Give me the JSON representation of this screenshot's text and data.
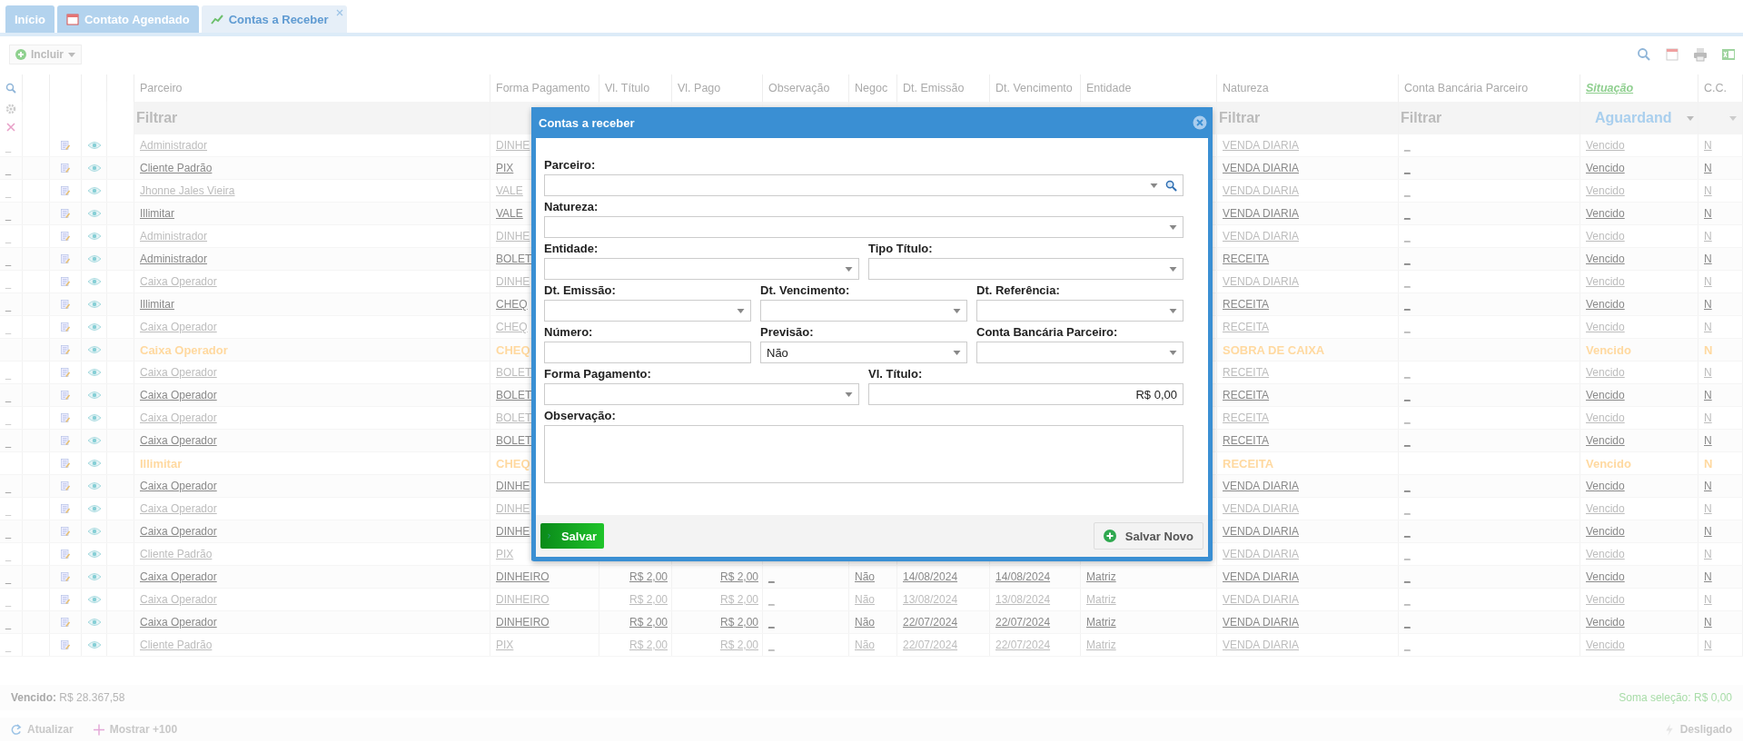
{
  "tabs": [
    {
      "label": "Início",
      "selected": false
    },
    {
      "label": "Contato Agendado",
      "selected": false
    },
    {
      "label": "Contas a Receber",
      "selected": true
    }
  ],
  "toolbar": {
    "add_button": "Incluir"
  },
  "columns": [
    {
      "label": "Parceiro",
      "sorted": false
    },
    {
      "label": "Forma Pagamento",
      "sorted": false
    },
    {
      "label": "Vl. Título",
      "sorted": false
    },
    {
      "label": "Vl. Pago",
      "sorted": false
    },
    {
      "label": "Observação",
      "sorted": false
    },
    {
      "label": "Negoc",
      "sorted": false
    },
    {
      "label": "Dt. Emissão",
      "sorted": false
    },
    {
      "label": "Dt. Vencimento",
      "sorted": false
    },
    {
      "label": "Entidade",
      "sorted": false
    },
    {
      "label": "Natureza",
      "sorted": false
    },
    {
      "label": "Conta Bancária Parceiro",
      "sorted": false
    },
    {
      "label": "Situação",
      "sorted": true
    },
    {
      "label": "C.C.",
      "sorted": false
    }
  ],
  "filters": {
    "parceiro": {
      "placeholder": "Filtrar"
    },
    "natureza": {
      "placeholder": "Filtrar"
    },
    "conta": {
      "placeholder": "Filtrar"
    },
    "situacao": {
      "value": "Aguardand"
    }
  },
  "rows": [
    {
      "warning": false,
      "lead": "_",
      "parceiro": "Administrador",
      "forma": "DINHE",
      "natureza": "VENDA DIARIA",
      "conta": "_",
      "situacao": "Vencido",
      "cc": "N"
    },
    {
      "warning": false,
      "lead": "_",
      "parceiro": "Cliente Padrão",
      "forma": "PIX",
      "natureza": "VENDA DIARIA",
      "conta": "_",
      "situacao": "Vencido",
      "cc": "N"
    },
    {
      "warning": false,
      "lead": "_",
      "parceiro": "Jhonne Jales Vieira",
      "forma": "VALE",
      "natureza": "VENDA DIARIA",
      "conta": "_",
      "situacao": "Vencido",
      "cc": "N"
    },
    {
      "warning": false,
      "lead": "_",
      "parceiro": "Illimitar",
      "forma": "VALE",
      "natureza": "VENDA DIARIA",
      "conta": "_",
      "situacao": "Vencido",
      "cc": "N"
    },
    {
      "warning": false,
      "lead": "_",
      "parceiro": "Administrador",
      "forma": "DINHE",
      "natureza": "VENDA DIARIA",
      "conta": "_",
      "situacao": "Vencido",
      "cc": "N"
    },
    {
      "warning": false,
      "lead": "_",
      "parceiro": "Administrador",
      "forma": "BOLET",
      "natureza": "RECEITA",
      "conta": "_",
      "situacao": "Vencido",
      "cc": "N"
    },
    {
      "warning": false,
      "lead": "_",
      "parceiro": "Caixa Operador",
      "forma": "DINHE",
      "natureza": "VENDA DIARIA",
      "conta": "_",
      "situacao": "Vencido",
      "cc": "N"
    },
    {
      "warning": false,
      "lead": "_",
      "parceiro": "Illimitar",
      "forma": "CHEQ",
      "natureza": "RECEITA",
      "conta": "_",
      "situacao": "Vencido",
      "cc": "N"
    },
    {
      "warning": false,
      "lead": "_",
      "parceiro": "Caixa Operador",
      "forma": "CHEQ",
      "natureza": "RECEITA",
      "conta": "_",
      "situacao": "Vencido",
      "cc": "N"
    },
    {
      "warning": true,
      "parceiro": "Caixa Operador",
      "forma": "CHEQ",
      "natureza": "SOBRA DE CAIXA",
      "situacao": "Vencido",
      "cc": "N"
    },
    {
      "warning": false,
      "lead": "_",
      "parceiro": "Caixa Operador",
      "forma": "BOLET",
      "natureza": "RECEITA",
      "conta": "_",
      "situacao": "Vencido",
      "cc": "N"
    },
    {
      "warning": false,
      "lead": "_",
      "parceiro": "Caixa Operador",
      "forma": "BOLET",
      "natureza": "RECEITA",
      "conta": "_",
      "situacao": "Vencido",
      "cc": "N"
    },
    {
      "warning": false,
      "lead": "_",
      "parceiro": "Caixa Operador",
      "forma": "BOLET",
      "natureza": "RECEITA",
      "conta": "_",
      "situacao": "Vencido",
      "cc": "N"
    },
    {
      "warning": false,
      "lead": "_",
      "parceiro": "Caixa Operador",
      "forma": "BOLET",
      "natureza": "RECEITA",
      "conta": "_",
      "situacao": "Vencido",
      "cc": "N"
    },
    {
      "warning": true,
      "parceiro": "Illimitar",
      "forma": "CHEQ",
      "natureza": "RECEITA",
      "situacao": "Vencido",
      "cc": "N"
    },
    {
      "warning": false,
      "lead": "_",
      "parceiro": "Caixa Operador",
      "forma": "DINHE",
      "natureza": "VENDA DIARIA",
      "conta": "_",
      "situacao": "Vencido",
      "cc": "N"
    },
    {
      "warning": false,
      "lead": "_",
      "parceiro": "Caixa Operador",
      "forma": "DINHE",
      "natureza": "VENDA DIARIA",
      "conta": "_",
      "situacao": "Vencido",
      "cc": "N"
    },
    {
      "warning": false,
      "lead": "_",
      "parceiro": "Caixa Operador",
      "forma": "DINHE",
      "natureza": "VENDA DIARIA",
      "conta": "_",
      "situacao": "Vencido",
      "cc": "N"
    },
    {
      "warning": false,
      "lead": "_",
      "parceiro": "Cliente Padrão",
      "forma": "PIX",
      "natureza": "VENDA DIARIA",
      "conta": "_",
      "situacao": "Vencido",
      "cc": "N"
    },
    {
      "warning": false,
      "lead": "_",
      "parceiro": "Caixa Operador",
      "forma": "DINHEIRO",
      "vl_titulo": "R$ 2,00",
      "vl_pago": "R$ 2,00",
      "observacao": "_",
      "negociado": "Não",
      "emissao": "14/08/2024",
      "vencimento": "14/08/2024",
      "entidade": "Matriz",
      "natureza": "VENDA DIARIA",
      "conta": "_",
      "situacao": "Vencido",
      "cc": "N"
    },
    {
      "warning": false,
      "lead": "_",
      "parceiro": "Caixa Operador",
      "forma": "DINHEIRO",
      "vl_titulo": "R$ 2,00",
      "vl_pago": "R$ 2,00",
      "observacao": "_",
      "negociado": "Não",
      "emissao": "13/08/2024",
      "vencimento": "13/08/2024",
      "entidade": "Matriz",
      "natureza": "VENDA DIARIA",
      "conta": "_",
      "situacao": "Vencido",
      "cc": "N"
    },
    {
      "warning": false,
      "lead": "_",
      "parceiro": "Caixa Operador",
      "forma": "DINHEIRO",
      "vl_titulo": "R$ 2,00",
      "vl_pago": "R$ 2,00",
      "observacao": "_",
      "negociado": "Não",
      "emissao": "22/07/2024",
      "vencimento": "22/07/2024",
      "entidade": "Matriz",
      "natureza": "VENDA DIARIA",
      "conta": "_",
      "situacao": "Vencido",
      "cc": "N"
    },
    {
      "warning": false,
      "lead": "_",
      "parceiro": "Cliente Padrão",
      "forma": "PIX",
      "vl_titulo": "R$ 2,00",
      "vl_pago": "R$ 2,00",
      "observacao": "_",
      "negociado": "Não",
      "emissao": "22/07/2024",
      "vencimento": "22/07/2024",
      "entidade": "Matriz",
      "natureza": "VENDA DIARIA",
      "conta": "_",
      "situacao": "Vencido",
      "cc": "N"
    }
  ],
  "footer": {
    "overdue_label": "Vencido:",
    "overdue_value": "R$ 28.367,58",
    "selection_sum": "Soma seleção: R$ 0,00"
  },
  "bottom_bar": {
    "refresh": "Atualizar",
    "more": "Mostrar +100",
    "connection": "Desligado"
  },
  "dialog": {
    "title": "Contas a receber",
    "rows": [
      [
        {
          "label": "Parceiro:",
          "kind": "lookup"
        }
      ],
      [
        {
          "label": "Natureza:",
          "kind": "select"
        }
      ],
      [
        {
          "label": "Entidade:",
          "kind": "select"
        },
        {
          "label": "Tipo Título:",
          "kind": "select"
        }
      ],
      [
        {
          "label": "Dt. Emissão:",
          "kind": "select"
        },
        {
          "label": "Dt. Vencimento:",
          "kind": "select"
        },
        {
          "label": "Dt. Referência:",
          "kind": "select"
        }
      ],
      [
        {
          "label": "Número:",
          "kind": "text"
        },
        {
          "label": "Previsão:",
          "kind": "select",
          "value": "Não"
        },
        {
          "label": "Conta Bancária Parceiro:",
          "kind": "select"
        }
      ],
      [
        {
          "label": "Forma Pagamento:",
          "kind": "select"
        },
        {
          "label": "Vl. Título:",
          "kind": "money",
          "value": "R$ 0,00"
        }
      ],
      [
        {
          "label": "Observação:",
          "kind": "textarea"
        }
      ]
    ],
    "save": "Salvar",
    "save_new": "Salvar Novo"
  }
}
